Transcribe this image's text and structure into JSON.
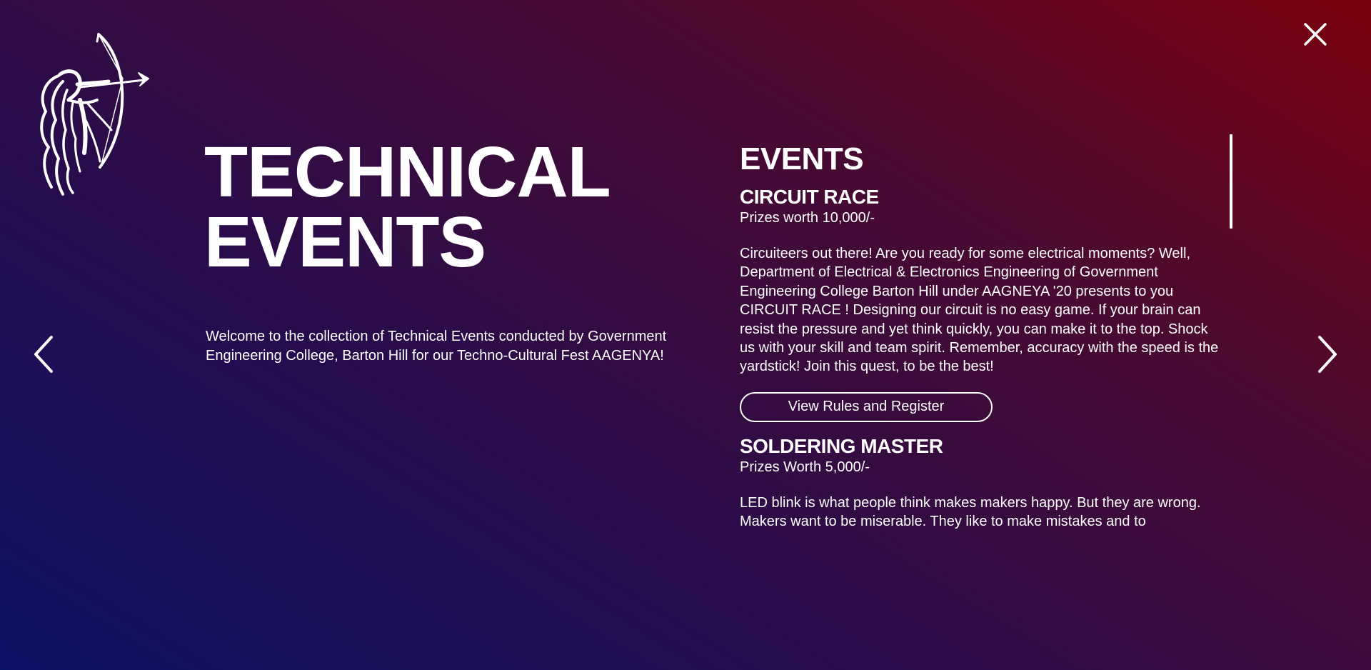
{
  "page": {
    "title_line1": "TECHNICAL",
    "title_line2": "EVENTS",
    "intro": "Welcome to the collection of Technical Events conducted by Government Engineering College, Barton Hill for our Techno-Cultural Fest AAGENYA!"
  },
  "events_panel": {
    "heading": "EVENTS",
    "items": [
      {
        "name": "CIRCUIT RACE",
        "prize": "Prizes worth 10,000/-",
        "description": "Circuiteers out there! Are you ready for some electrical moments? Well, Department of Electrical & Electronics Engineering of Government Engineering College Barton Hill under AAGNEYA '20 presents to you CIRCUIT RACE ! Designing our circuit is no easy game. If your brain can resist the pressure and yet think quickly, you can make it to the top. Shock us with your skill and team spirit. Remember, accuracy with the speed is the yardstick! Join this quest, to be the best!",
        "button_label": "View Rules and Register"
      },
      {
        "name": "SOLDERING MASTER",
        "prize": "Prizes Worth 5,000/-",
        "description": "LED blink is what people think makes makers happy. But they are wrong. Makers want to be miserable. They like to make mistakes and to"
      }
    ]
  },
  "icons": {
    "logo": "archer-logo",
    "close": "close-icon",
    "prev": "chevron-left-icon",
    "next": "chevron-right-icon"
  },
  "colors": {
    "gradient_start": "#0b1164",
    "gradient_mid": "#2a0c4a",
    "gradient_end": "#7a0210",
    "text": "#ffffff"
  }
}
